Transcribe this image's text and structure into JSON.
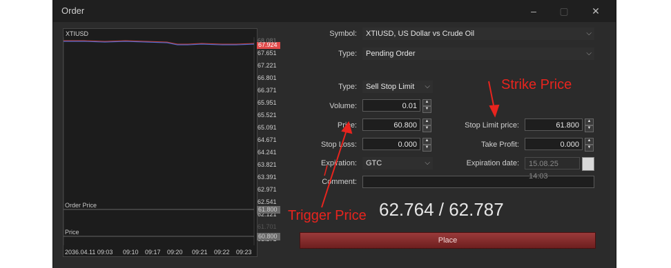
{
  "window": {
    "title": "Order",
    "minimize": "–",
    "maximize": "▢",
    "close": "✕"
  },
  "chart": {
    "symbol": "XTIUSD",
    "price_labels": [
      "68.081",
      "67.651",
      "67.221",
      "66.801",
      "66.371",
      "65.951",
      "65.521",
      "65.091",
      "64.671",
      "64.241",
      "63.821",
      "63.391",
      "62.971",
      "62.541",
      "62.121",
      "61.701",
      "61.271",
      "60.851"
    ],
    "current_price": "67.924",
    "order_price_tag": "61.800",
    "price_tag": "60.800",
    "order_price_label": "Order Price",
    "price_label": "Price",
    "time_labels": [
      "2036.04.11 09:03",
      "09:10",
      "09:17",
      "09:20",
      "09:21",
      "09:22",
      "09:23"
    ]
  },
  "form": {
    "symbol_label": "Symbol:",
    "symbol_value": "XTIUSD, US Dollar vs Crude Oil",
    "type_label": "Type:",
    "type_value": "Pending Order",
    "order_type_label": "Type:",
    "order_type_value": "Sell Stop Limit",
    "volume_label": "Volume:",
    "volume_value": "0.01",
    "price_label": "Price:",
    "price_value": "60.800",
    "stop_loss_label": "Stop Loss:",
    "stop_loss_value": "0.000",
    "expiration_label": "Expiration:",
    "expiration_value": "GTC",
    "comment_label": "Comment:",
    "comment_value": "",
    "stop_limit_label": "Stop Limit price:",
    "stop_limit_value": "61.800",
    "take_profit_label": "Take Profit:",
    "take_profit_value": "0.000",
    "expiration_date_label": "Expiration date:",
    "expiration_date_value": "15.08.25 14:03"
  },
  "quote": "62.764 / 62.787",
  "place_label": "Place",
  "annotations": {
    "strike": "Strike Price",
    "trigger": "Trigger Price"
  },
  "colors": {
    "annotation": "#e8241e",
    "place_button": "#8a2d2d",
    "current_price_tag": "#e04a4a"
  }
}
